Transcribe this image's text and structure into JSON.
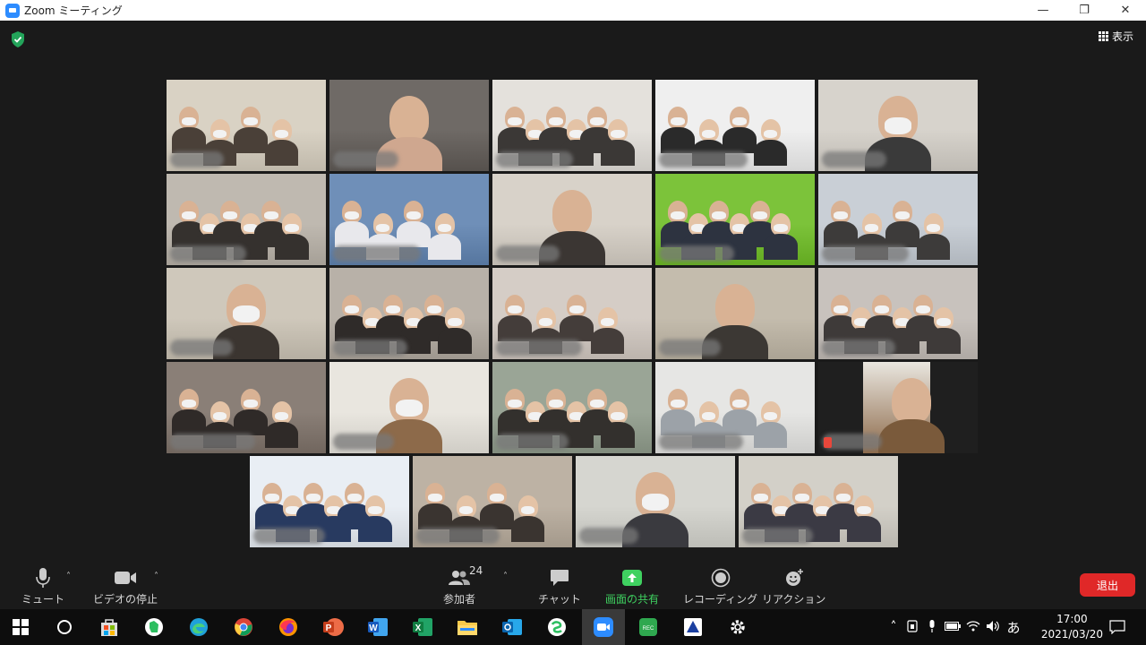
{
  "window": {
    "title": "Zoom ミーティング",
    "minimize_icon": "minimize-icon",
    "restore_icon": "restore-icon",
    "close_icon": "close-icon"
  },
  "meeting": {
    "security_icon": "shield-check-icon",
    "view_label": "表示",
    "active_speaker_color": "#c7e55b"
  },
  "toolbar": {
    "mute_label": "ミュート",
    "video_label": "ビデオの停止",
    "participants_label": "参加者",
    "participants_count": "24",
    "chat_label": "チャット",
    "share_label": "画面の共有",
    "record_label": "レコーディング",
    "reactions_label": "リアクション",
    "leave_label": "退出",
    "share_color": "#3fd160",
    "leave_color": "#e02828"
  },
  "taskbar": {
    "apps": [
      "windows-start",
      "cortana-search",
      "microsoft-store",
      "evernote",
      "edge",
      "chrome",
      "firefox",
      "powerpoint",
      "word",
      "excel",
      "file-explorer",
      "outlook",
      "spreadsheet-app",
      "zoom",
      "recorder",
      "scanner",
      "settings"
    ],
    "ime_label": "あ",
    "time": "17:00",
    "date": "2021/03/20"
  }
}
